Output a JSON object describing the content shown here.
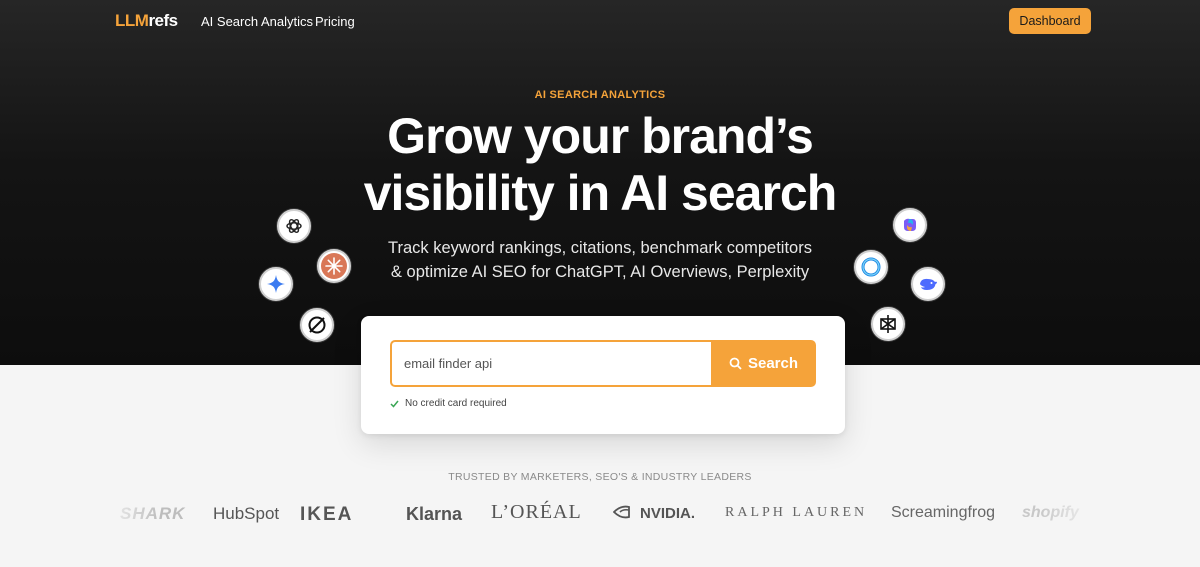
{
  "nav": {
    "logo_prefix": "LLM",
    "logo_suffix": "refs",
    "links": [
      "AI Search Analytics",
      "Pricing"
    ],
    "dashboard_label": "Dashboard"
  },
  "hero": {
    "eyebrow": "AI SEARCH ANALYTICS",
    "headline_line1": "Grow your brand’s",
    "headline_line2": "visibility in AI search",
    "subline_line1": "Track keyword rankings, citations, benchmark competitors",
    "subline_line2": "& optimize AI SEO for ChatGPT, AI Overviews, Perplexity"
  },
  "ai_icons": [
    "chatgpt-icon",
    "claude-icon",
    "gemini-icon",
    "grok-icon",
    "copilot-icon",
    "meta-ai-icon",
    "deepseek-icon",
    "perplexity-icon"
  ],
  "search": {
    "value": "email finder api",
    "button_label": "Search",
    "note": "No credit card required"
  },
  "trusted": {
    "heading": "TRUSTED BY MARKETERS, SEO'S & INDUSTRY LEADERS",
    "brands": {
      "shark": "SHARK",
      "hubspot": "HubSpot",
      "ikea": "IKEA",
      "klarna": "Klarna",
      "loreal": "L’ORÉAL",
      "nvidia": "NVIDIA.",
      "ralph": "RALPH LAUREN",
      "scream": "Screamingfrog",
      "shopify": "shopify"
    }
  },
  "colors": {
    "accent": "#f5a33a",
    "hero_bg": "#141414",
    "page_bg": "#f5f5f5"
  }
}
